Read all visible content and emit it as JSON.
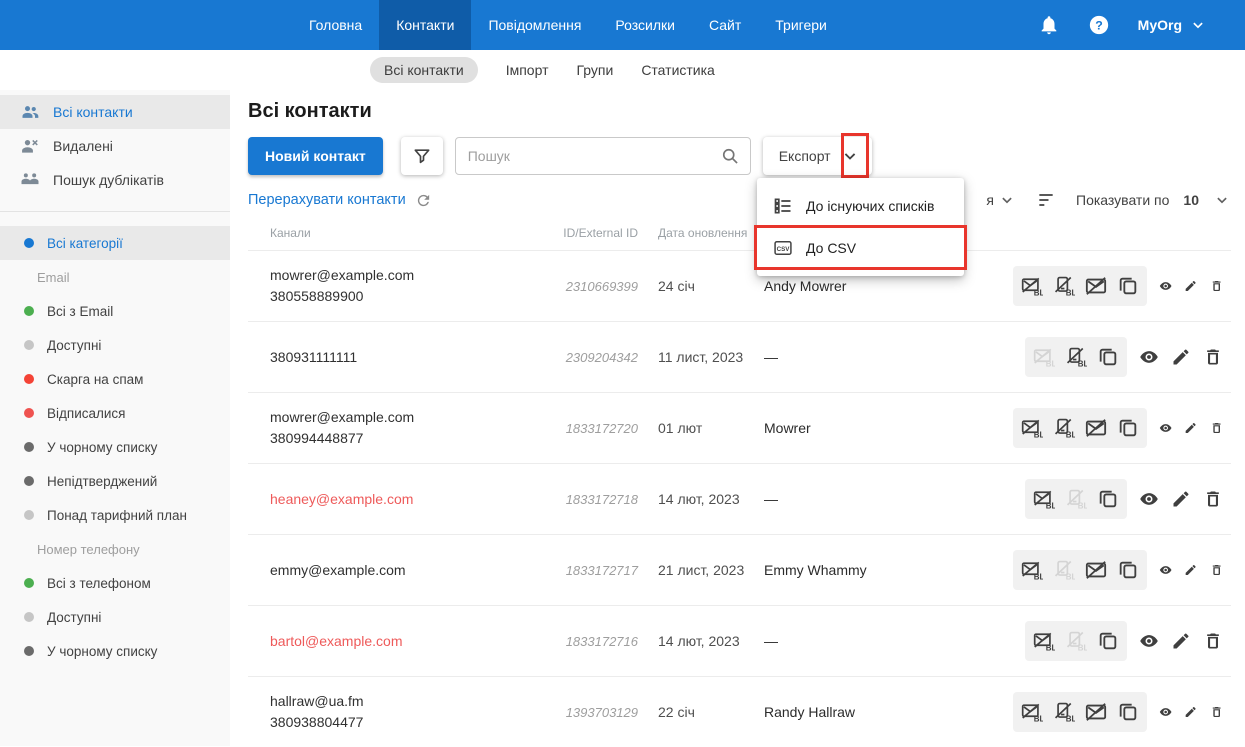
{
  "topnav": {
    "items": [
      {
        "label": "Головна",
        "active": false
      },
      {
        "label": "Контакти",
        "active": true
      },
      {
        "label": "Повідомлення",
        "active": false
      },
      {
        "label": "Розсилки",
        "active": false
      },
      {
        "label": "Сайт",
        "active": false
      },
      {
        "label": "Тригери",
        "active": false
      }
    ],
    "org_label": "MyOrg"
  },
  "tabs": [
    {
      "label": "Всі контакти",
      "active": true
    },
    {
      "label": "Імпорт",
      "active": false
    },
    {
      "label": "Групи",
      "active": false
    },
    {
      "label": "Статистика",
      "active": false
    }
  ],
  "sidebar": {
    "top_items": [
      {
        "label": "Всі контакти",
        "icon": "people-icon",
        "active": true
      },
      {
        "label": "Видалені",
        "icon": "person-remove-icon",
        "active": false
      },
      {
        "label": "Пошук дублікатів",
        "icon": "duplicates-icon",
        "active": false
      }
    ],
    "categories": [
      {
        "type": "item",
        "label": "Всі категорії",
        "dot": "#1878d2",
        "active": true
      },
      {
        "type": "header",
        "label": "Email"
      },
      {
        "type": "item",
        "label": "Всі з Email",
        "dot": "#4caf50",
        "active": false
      },
      {
        "type": "item",
        "label": "Доступні",
        "dot": "#c6c6c6",
        "active": false
      },
      {
        "type": "item",
        "label": "Скарга на спам",
        "dot": "#f44336",
        "active": false
      },
      {
        "type": "item",
        "label": "Відписалися",
        "dot": "#ef5350",
        "active": false
      },
      {
        "type": "item",
        "label": "У чорному списку",
        "dot": "#6b6b6b",
        "active": false
      },
      {
        "type": "item",
        "label": "Непідтверджений",
        "dot": "#6b6b6b",
        "active": false
      },
      {
        "type": "item",
        "label": "Понад тарифний план",
        "dot": "#c6c6c6",
        "active": false
      },
      {
        "type": "header",
        "label": "Номер телефону"
      },
      {
        "type": "item",
        "label": "Всі з телефоном",
        "dot": "#4caf50",
        "active": false
      },
      {
        "type": "item",
        "label": "Доступні",
        "dot": "#c6c6c6",
        "active": false
      },
      {
        "type": "item",
        "label": "У чорному списку",
        "dot": "#6b6b6b",
        "active": false
      }
    ]
  },
  "main": {
    "title": "Всі контакти",
    "new_contact_button": "Новий контакт",
    "search_placeholder": "Пошук",
    "export_button": "Експорт",
    "recalculate_link": "Перерахувати контакти",
    "sort_label_fragment": "я",
    "per_page_label": "Показувати по",
    "per_page_value": "10",
    "export_menu": [
      {
        "label": "До існуючих списків",
        "icon": "lists-icon",
        "highlighted": false
      },
      {
        "label": "До CSV",
        "icon": "csv-icon",
        "highlighted": true
      }
    ]
  },
  "table": {
    "headers": [
      "Канали",
      "ID/External ID",
      "Дата оновлення"
    ],
    "rows": [
      {
        "channels": [
          {
            "text": "mowrer@example.com",
            "alert": false
          },
          {
            "text": "380558889900",
            "alert": false
          }
        ],
        "id": "2310669399",
        "date": "24 січ",
        "name": "Andy Mowrer",
        "icons": [
          {
            "name": "email-blacklist-icon",
            "disabled": false
          },
          {
            "name": "phone-blacklist-icon",
            "disabled": false
          },
          {
            "name": "email-slash-icon",
            "disabled": false
          },
          {
            "name": "copy-icon",
            "disabled": false
          }
        ]
      },
      {
        "channels": [
          {
            "text": "380931111111",
            "alert": false
          }
        ],
        "id": "2309204342",
        "date": "11 лист, 2023",
        "name": "—",
        "icons": [
          {
            "name": "email-blacklist-icon",
            "disabled": true
          },
          {
            "name": "phone-blacklist-icon",
            "disabled": false
          },
          {
            "name": "copy-icon",
            "disabled": false
          }
        ]
      },
      {
        "channels": [
          {
            "text": "mowrer@example.com",
            "alert": false
          },
          {
            "text": "380994448877",
            "alert": false
          }
        ],
        "id": "1833172720",
        "date": "01 лют",
        "name": "Mowrer",
        "icons": [
          {
            "name": "email-blacklist-icon",
            "disabled": false
          },
          {
            "name": "phone-blacklist-icon",
            "disabled": false
          },
          {
            "name": "email-slash-icon",
            "disabled": false
          },
          {
            "name": "copy-icon",
            "disabled": false
          }
        ]
      },
      {
        "channels": [
          {
            "text": "heaney@example.com",
            "alert": true
          }
        ],
        "id": "1833172718",
        "date": "14 лют, 2023",
        "name": "—",
        "icons": [
          {
            "name": "email-blacklist-icon",
            "disabled": false
          },
          {
            "name": "phone-blacklist-icon",
            "disabled": true
          },
          {
            "name": "copy-icon",
            "disabled": false
          }
        ]
      },
      {
        "channels": [
          {
            "text": "emmy@example.com",
            "alert": false
          }
        ],
        "id": "1833172717",
        "date": "21 лист, 2023",
        "name": "Emmy Whammy",
        "icons": [
          {
            "name": "email-blacklist-icon",
            "disabled": false
          },
          {
            "name": "phone-blacklist-icon",
            "disabled": true
          },
          {
            "name": "email-slash-icon",
            "disabled": false
          },
          {
            "name": "copy-icon",
            "disabled": false
          }
        ]
      },
      {
        "channels": [
          {
            "text": "bartol@example.com",
            "alert": true
          }
        ],
        "id": "1833172716",
        "date": "14 лют, 2023",
        "name": "—",
        "icons": [
          {
            "name": "email-blacklist-icon",
            "disabled": false
          },
          {
            "name": "phone-blacklist-icon",
            "disabled": true
          },
          {
            "name": "copy-icon",
            "disabled": false
          }
        ]
      },
      {
        "channels": [
          {
            "text": "hallraw@ua.fm",
            "alert": false
          },
          {
            "text": "380938804477",
            "alert": false
          }
        ],
        "id": "1393703129",
        "date": "22 січ",
        "name": "Randy Hallraw",
        "icons": [
          {
            "name": "email-blacklist-icon",
            "disabled": false
          },
          {
            "name": "phone-blacklist-icon",
            "disabled": false
          },
          {
            "name": "email-slash-icon",
            "disabled": false
          },
          {
            "name": "copy-icon",
            "disabled": false
          }
        ]
      }
    ],
    "row_actions": [
      "eye-icon",
      "pencil-icon",
      "trash-icon"
    ]
  },
  "colors": {
    "accent_blue": "#1878d2",
    "annotation_red": "#e8352c",
    "alert_email": "#ee5a5a"
  }
}
